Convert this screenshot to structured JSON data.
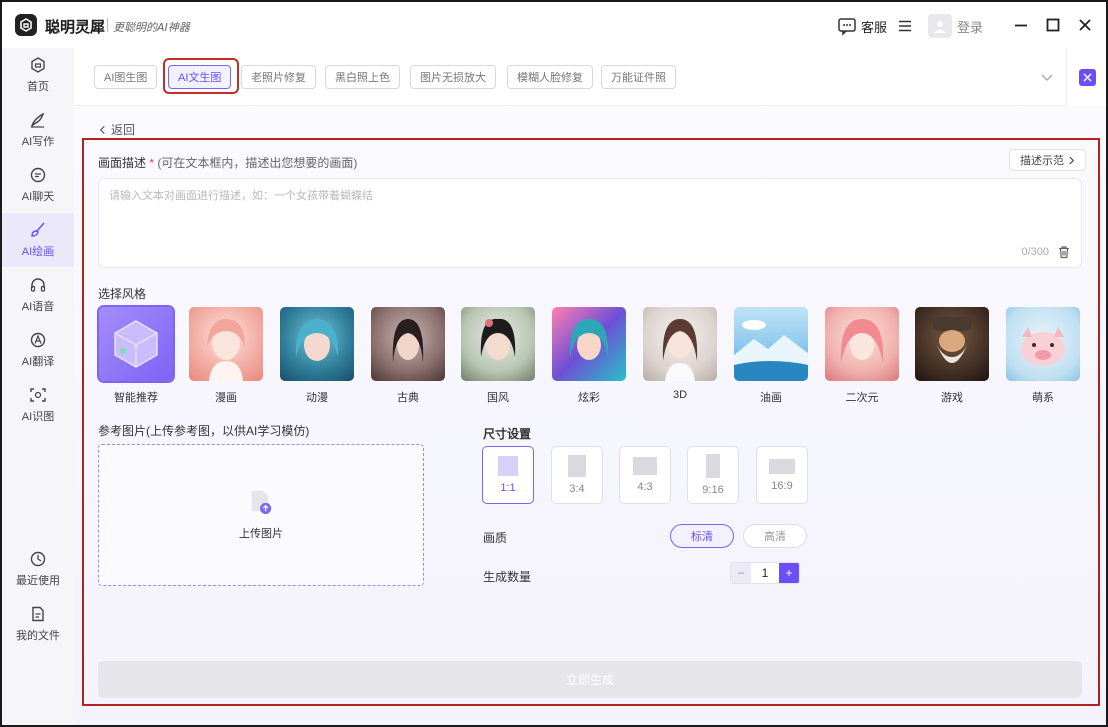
{
  "app": {
    "name": "聪明灵犀",
    "slogan": "更聪明的AI神器"
  },
  "titlebar": {
    "service_label": "客服",
    "login_label": "登录"
  },
  "sidebar": {
    "items": [
      {
        "label": "首页",
        "icon": "home-icon"
      },
      {
        "label": "AI写作",
        "icon": "pen-icon"
      },
      {
        "label": "AI聊天",
        "icon": "chat-icon"
      },
      {
        "label": "AI绘画",
        "icon": "brush-icon",
        "active": true
      },
      {
        "label": "AI语音",
        "icon": "voice-icon"
      },
      {
        "label": "AI翻译",
        "icon": "translate-icon"
      },
      {
        "label": "AI识图",
        "icon": "scan-icon"
      }
    ],
    "bottom_items": [
      {
        "label": "最近使用",
        "icon": "clock-icon"
      },
      {
        "label": "我的文件",
        "icon": "file-icon"
      }
    ]
  },
  "tabs": [
    {
      "label": "AI图生图"
    },
    {
      "label": "AI文生图",
      "active": true
    },
    {
      "label": "老照片修复"
    },
    {
      "label": "黑白照上色"
    },
    {
      "label": "图片无损放大"
    },
    {
      "label": "模糊人脸修复"
    },
    {
      "label": "万能证件照"
    }
  ],
  "back_label": "返回",
  "prompt": {
    "label": "画面描述",
    "required_mark": "*",
    "hint": "(可在文本框内，描述出您想要的画面)",
    "example_label": "描述示范",
    "placeholder": "请输入文本对画面进行描述，如：一个女孩带着蝴蝶结",
    "value": "",
    "counter": "0/300"
  },
  "styles": {
    "label": "选择风格",
    "items": [
      {
        "name": "智能推荐",
        "active": true
      },
      {
        "name": "漫画"
      },
      {
        "name": "动漫"
      },
      {
        "name": "古典"
      },
      {
        "name": "国风"
      },
      {
        "name": "炫彩"
      },
      {
        "name": "3D"
      },
      {
        "name": "油画"
      },
      {
        "name": "二次元"
      },
      {
        "name": "游戏"
      },
      {
        "name": "萌系"
      }
    ]
  },
  "reference": {
    "label": "参考图片(上传参考图，以供AI学习模仿)",
    "upload_label": "上传图片"
  },
  "size": {
    "label": "尺寸设置",
    "options": [
      {
        "ratio": "1:1",
        "active": true
      },
      {
        "ratio": "3:4"
      },
      {
        "ratio": "4:3"
      },
      {
        "ratio": "9:16"
      },
      {
        "ratio": "16:9"
      }
    ]
  },
  "quality": {
    "label": "画质",
    "options": [
      {
        "label": "标清",
        "active": true
      },
      {
        "label": "高清"
      }
    ]
  },
  "count": {
    "label": "生成数量",
    "value": "1",
    "minus": "−",
    "plus": "+"
  },
  "generate_label": "立即生成",
  "colors": {
    "accent": "#6b4ef5",
    "highlight_border": "#b22222"
  }
}
